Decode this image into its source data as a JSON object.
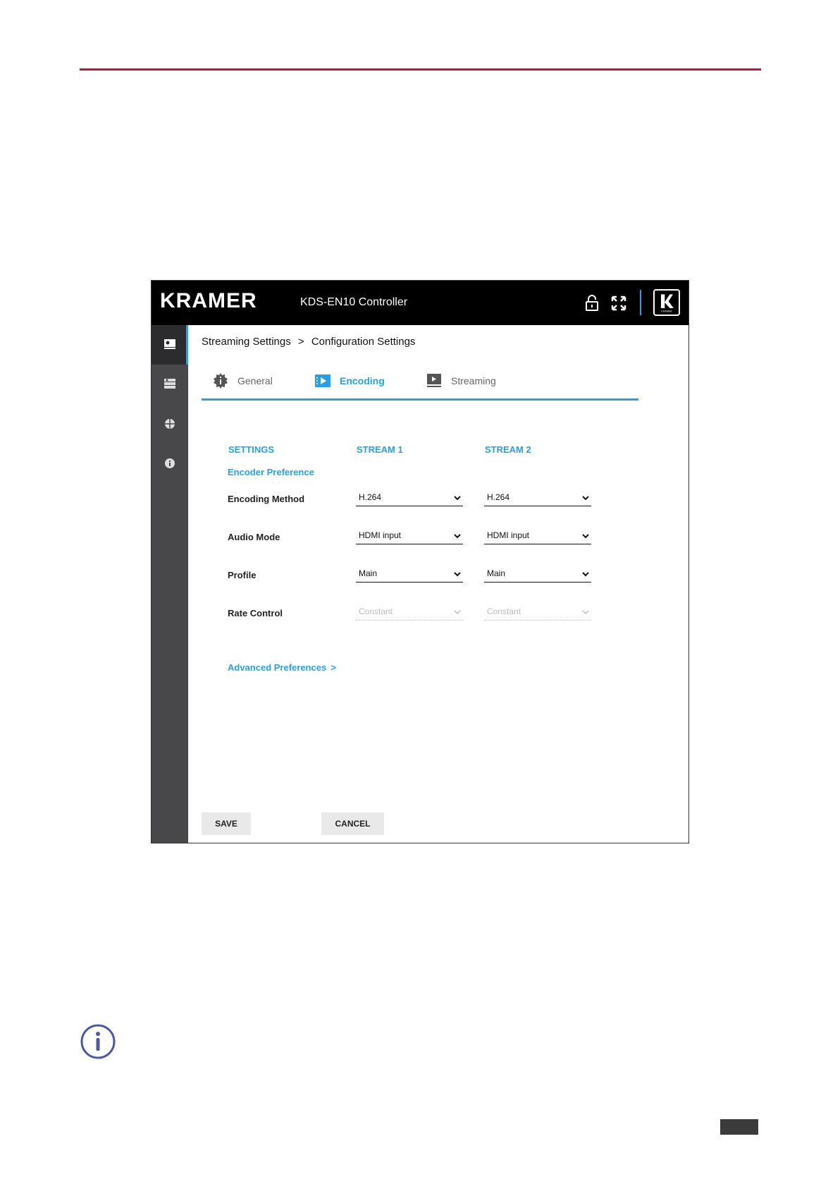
{
  "window": {
    "brand": "KRAMER",
    "title": "KDS-EN10 Controller",
    "logo_text": "KRAMER"
  },
  "breadcrumb": {
    "items": [
      "Streaming Settings",
      ">",
      "Configuration Settings"
    ]
  },
  "tabs": [
    {
      "label": "General",
      "icon": "info-gear-icon"
    },
    {
      "label": "Encoding",
      "icon": "encoding-icon",
      "active": true
    },
    {
      "label": "Streaming",
      "icon": "streaming-icon"
    }
  ],
  "table": {
    "headers": [
      "SETTINGS",
      "STREAM 1",
      "STREAM 2"
    ],
    "section": "Encoder Preference",
    "rows": [
      {
        "label": "Encoding Method",
        "stream1": "H.264",
        "stream2": "H.264",
        "enabled": true
      },
      {
        "label": "Audio Mode",
        "stream1": "HDMI input",
        "stream2": "HDMI input",
        "enabled": true
      },
      {
        "label": "Profile",
        "stream1": "Main",
        "stream2": "Main",
        "enabled": true
      },
      {
        "label": "Rate Control",
        "stream1": "Constant",
        "stream2": "Constant",
        "enabled": false
      }
    ]
  },
  "advanced_link": "Advanced Preferences",
  "advanced_chevron": ">",
  "buttons": {
    "save": "SAVE",
    "cancel": "CANCEL"
  },
  "colors": {
    "accent": "#29a0e6",
    "rule": "#c0163a",
    "sidebar": "#48484a"
  }
}
